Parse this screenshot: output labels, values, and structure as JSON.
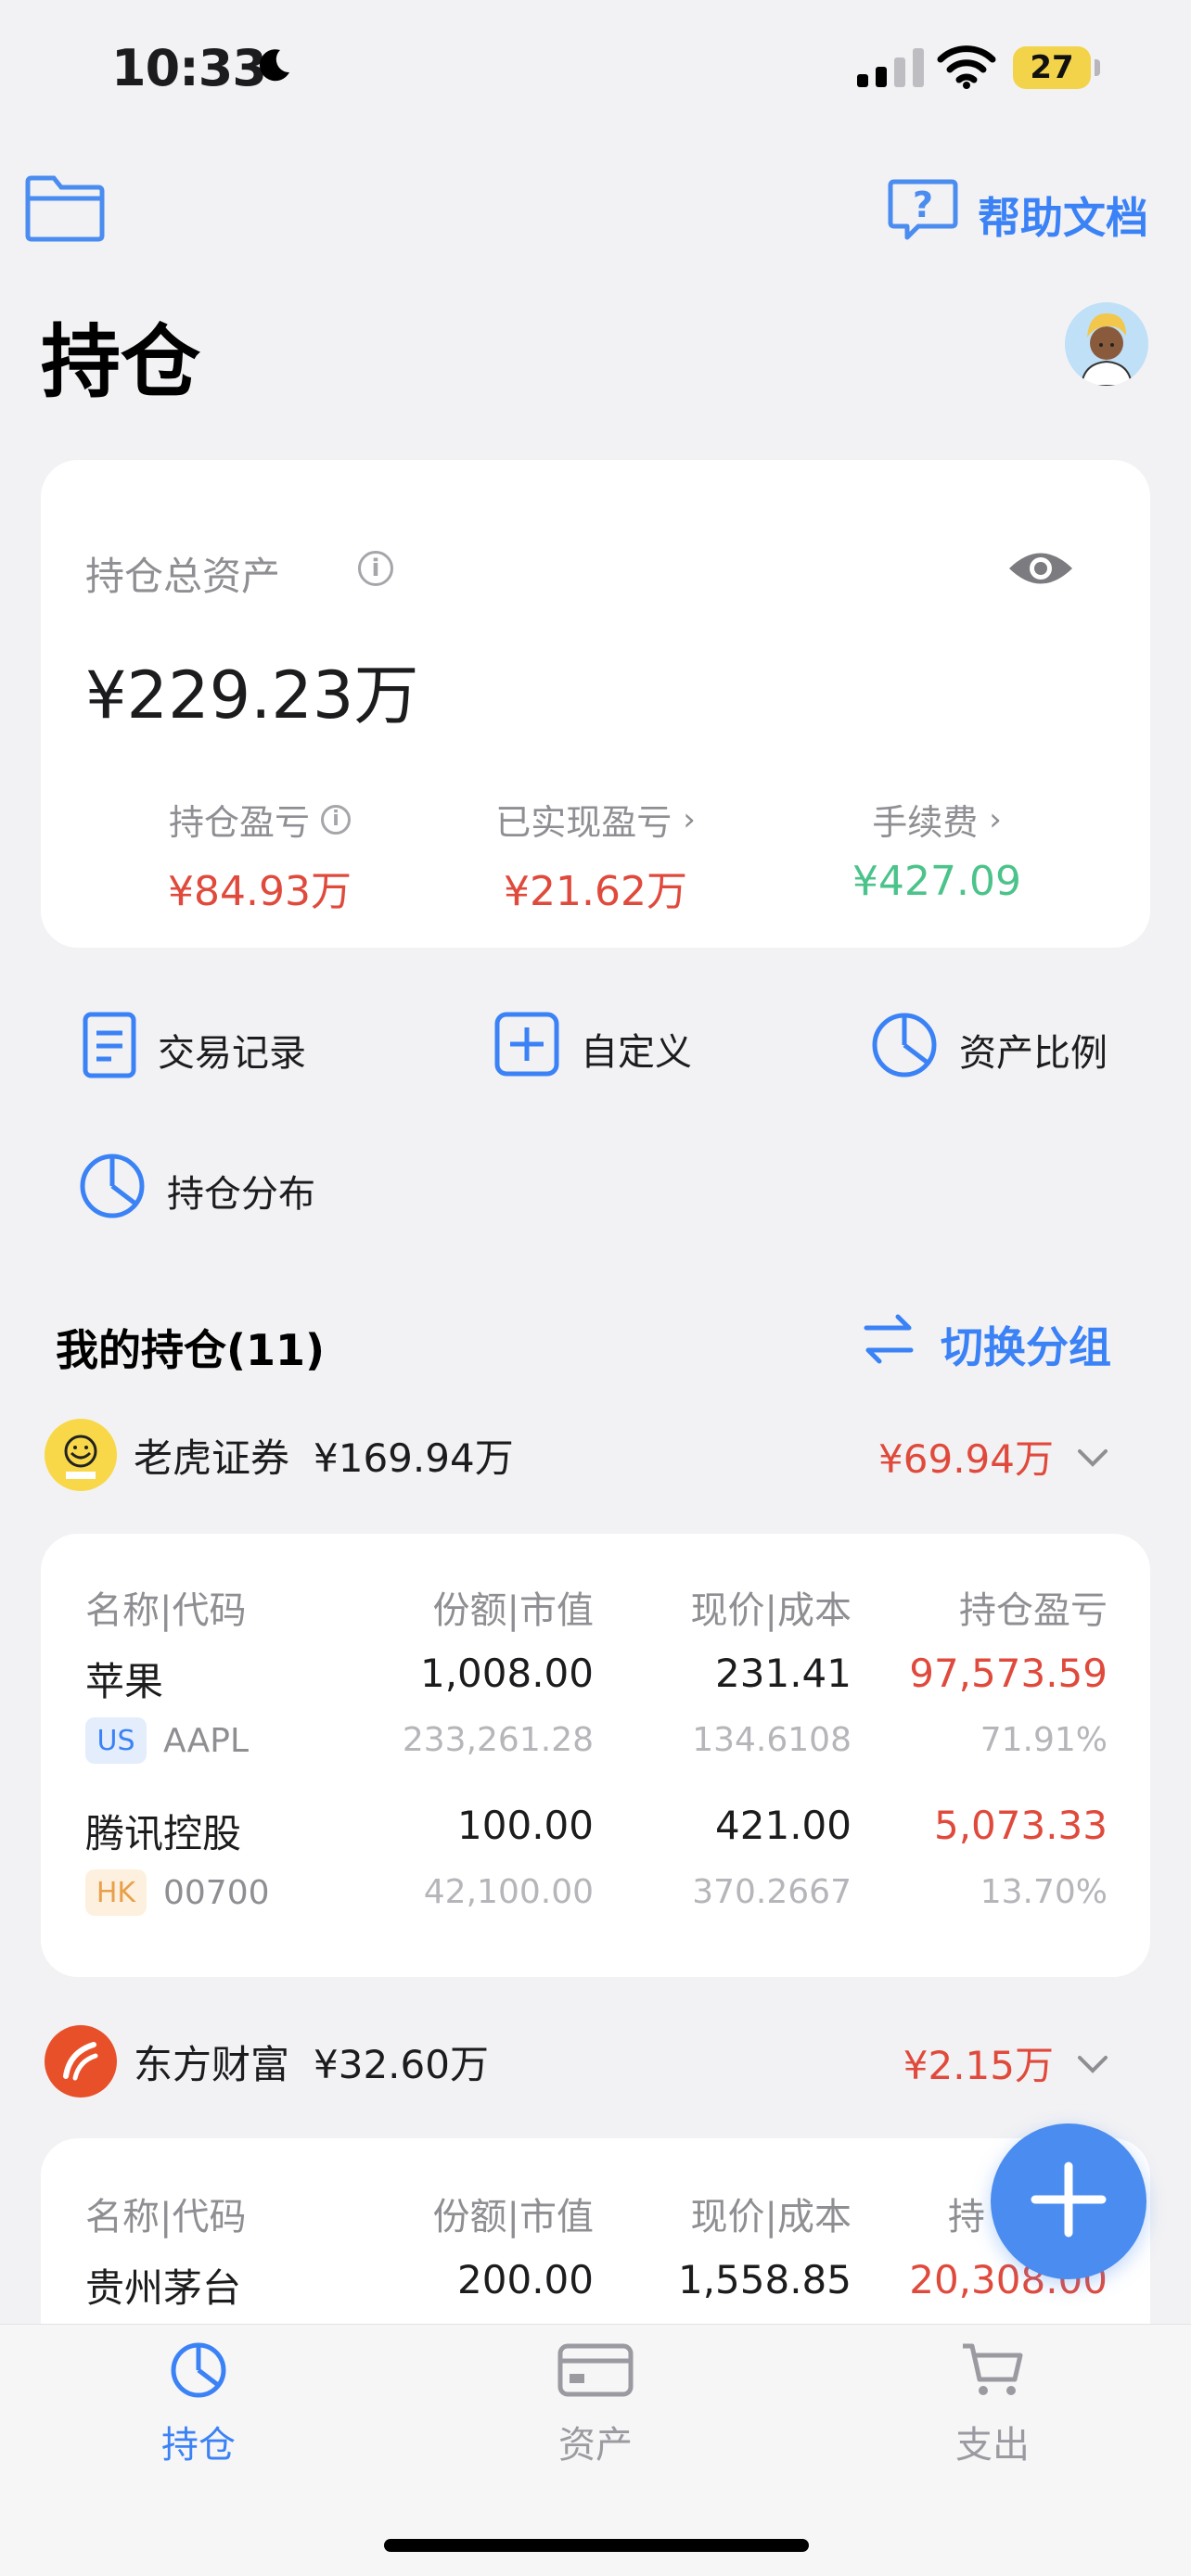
{
  "status_bar": {
    "time": "10:33",
    "battery": "27"
  },
  "header": {
    "help_label": "帮助文档",
    "title": "持仓"
  },
  "summary": {
    "label": "持仓总资产",
    "total": "¥229.23万",
    "stats": [
      {
        "label": "持仓盈亏",
        "value": "¥84.93万",
        "color": "#e04a3c"
      },
      {
        "label": "已实现盈亏",
        "value": "¥21.62万",
        "color": "#e04a3c"
      },
      {
        "label": "手续费",
        "value": "¥427.09",
        "color": "#4cc38a"
      }
    ]
  },
  "actions": [
    {
      "label": "交易记录",
      "icon": "document-icon"
    },
    {
      "label": "自定义",
      "icon": "plus-square-icon"
    },
    {
      "label": "资产比例",
      "icon": "pie-chart-icon"
    },
    {
      "label": "持仓分布",
      "icon": "pie-chart-icon"
    }
  ],
  "holdings": {
    "title": "我的持仓(11)",
    "switch_label": "切换分组",
    "columns": [
      "名称|代码",
      "份额|市值",
      "现价|成本",
      "持仓盈亏"
    ],
    "brokers": [
      {
        "name": "老虎证券",
        "amount": "¥169.94万",
        "pnl": "¥69.94万",
        "rows": [
          {
            "name": "苹果",
            "market": "US",
            "code": "AAPL",
            "shares": "1,008.00",
            "value": "233,261.28",
            "price": "231.41",
            "cost": "134.6108",
            "pnl": "97,573.59",
            "pnl_pct": "71.91%"
          },
          {
            "name": "腾讯控股",
            "market": "HK",
            "code": "00700",
            "shares": "100.00",
            "value": "42,100.00",
            "price": "421.00",
            "cost": "370.2667",
            "pnl": "5,073.33",
            "pnl_pct": "13.70%"
          }
        ]
      },
      {
        "name": "东方财富",
        "amount": "¥32.60万",
        "pnl": "¥2.15万",
        "columns_visible": [
          "名称|代码",
          "份额|市值",
          "现价|成本",
          "持"
        ],
        "rows": [
          {
            "name": "贵州茅台",
            "shares": "200.00",
            "price": "1,558.85",
            "pnl": "20,308.00"
          }
        ]
      }
    ]
  },
  "tabs": [
    {
      "label": "持仓",
      "icon": "pie-chart-icon",
      "active": true
    },
    {
      "label": "资产",
      "icon": "card-icon",
      "active": false
    },
    {
      "label": "支出",
      "icon": "cart-icon",
      "active": false
    }
  ],
  "colors": {
    "accent": "#3b82f6",
    "profit": "#e04a3c",
    "fee": "#4cc38a"
  }
}
